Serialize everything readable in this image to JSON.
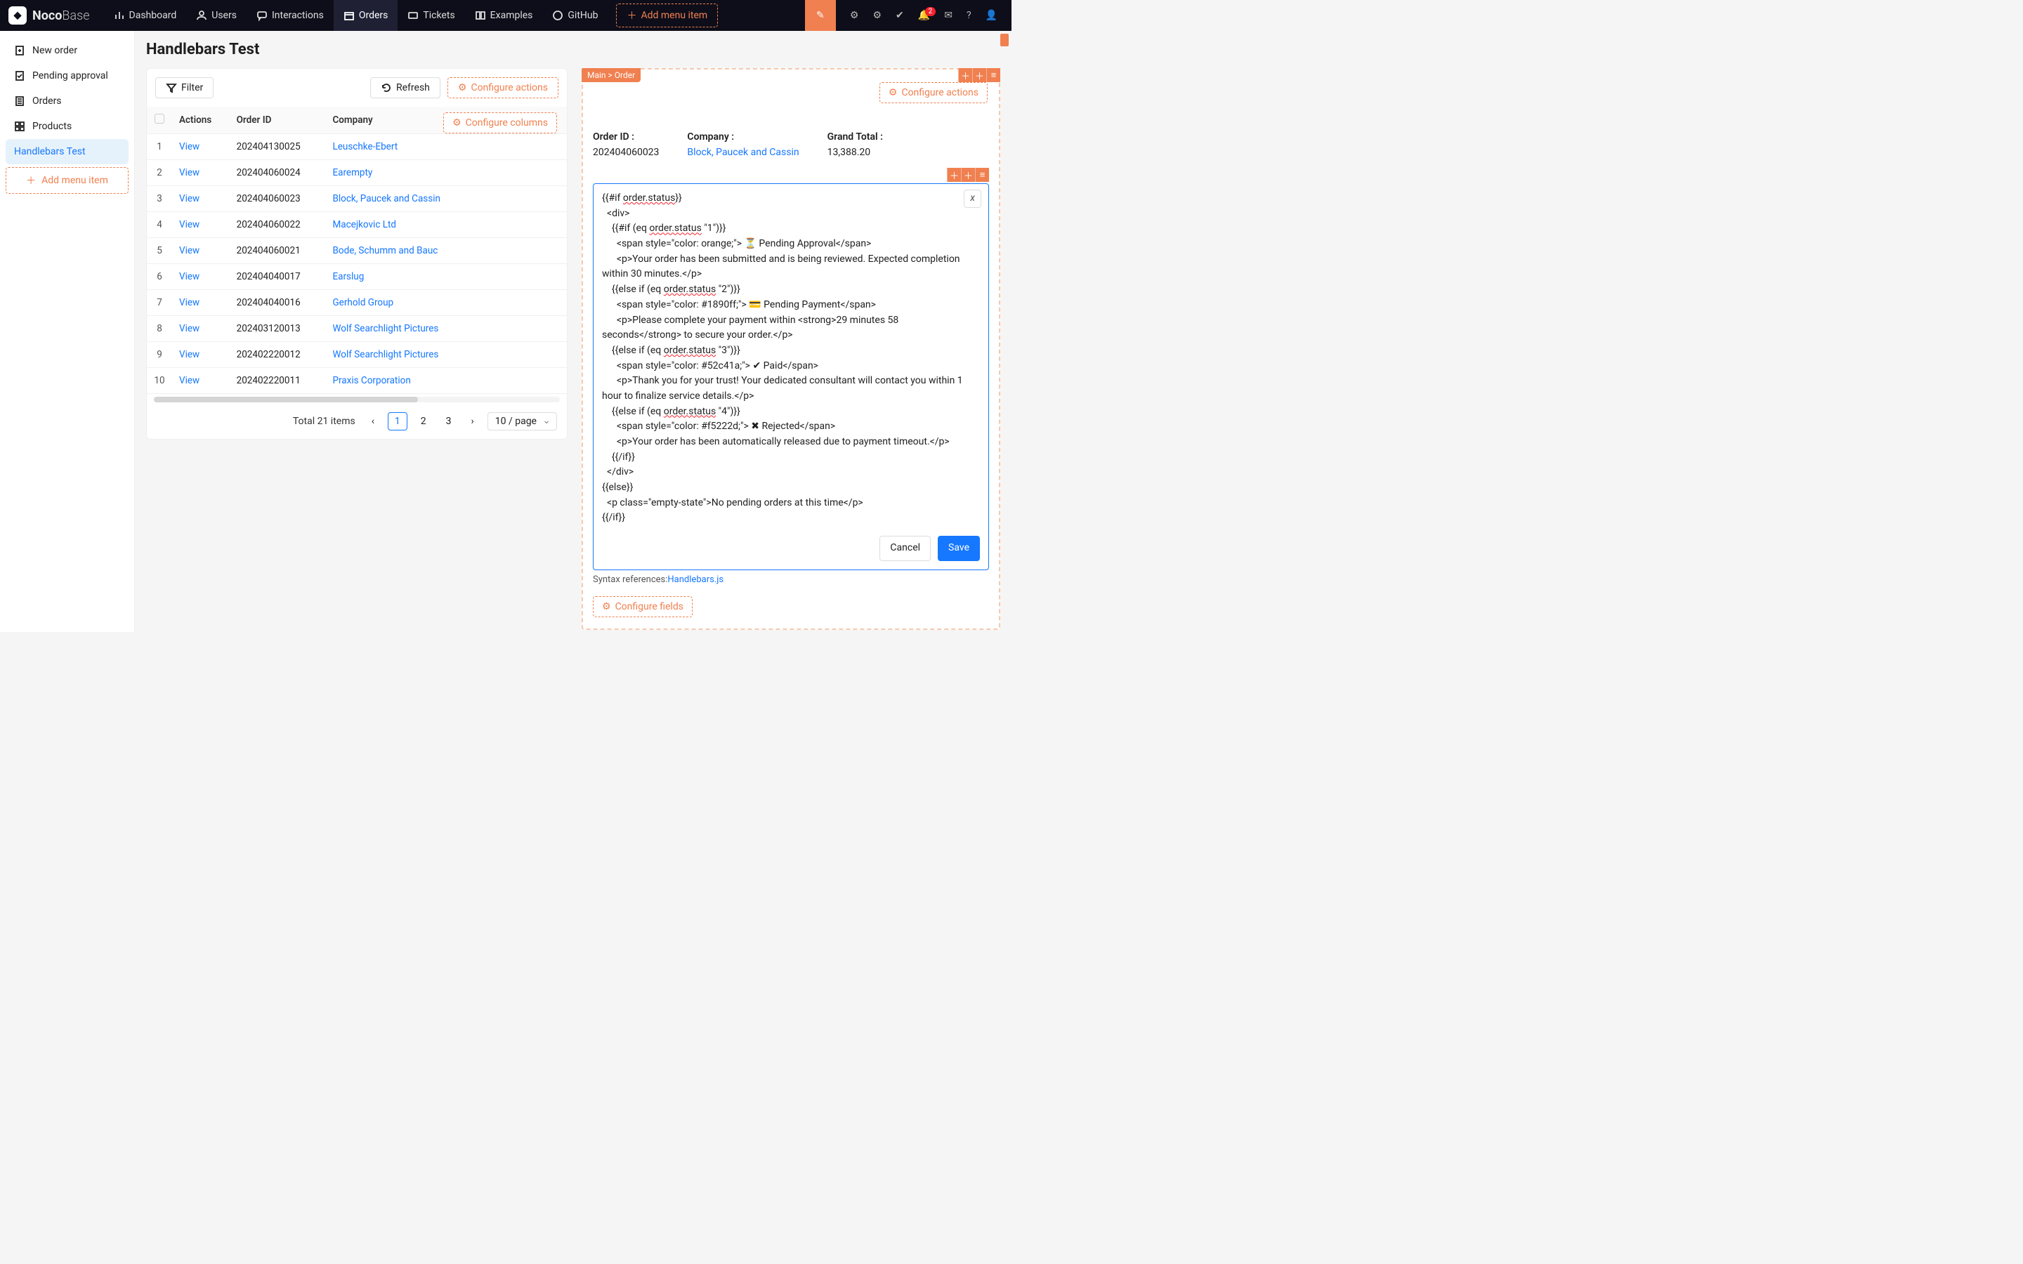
{
  "brand": {
    "name_bold": "Noco",
    "name_light": "Base"
  },
  "topnav": [
    {
      "label": "Dashboard",
      "icon": "chart-icon"
    },
    {
      "label": "Users",
      "icon": "users-icon"
    },
    {
      "label": "Interactions",
      "icon": "chat-icon"
    },
    {
      "label": "Orders",
      "icon": "box-icon",
      "active": true
    },
    {
      "label": "Tickets",
      "icon": "ticket-icon"
    },
    {
      "label": "Examples",
      "icon": "columns-icon"
    },
    {
      "label": "GitHub",
      "icon": "github-icon"
    }
  ],
  "topnav_add": "Add menu item",
  "topbar": {
    "bell_badge": "2"
  },
  "sidebar": [
    {
      "label": "New order",
      "icon": "plus-doc-icon"
    },
    {
      "label": "Pending approval",
      "icon": "approve-icon"
    },
    {
      "label": "Orders",
      "icon": "list-icon"
    },
    {
      "label": "Products",
      "icon": "grid-icon"
    },
    {
      "label": "Handlebars Test",
      "icon": "",
      "active": true
    }
  ],
  "sidebar_add": "Add menu item",
  "page_title": "Handlebars Test",
  "buttons": {
    "filter": "Filter",
    "refresh": "Refresh",
    "configure_actions": "Configure actions",
    "configure_columns": "Configure columns",
    "view": "View",
    "cancel": "Cancel",
    "save": "Save",
    "configure_fields": "Configure fields"
  },
  "table": {
    "headers": {
      "actions": "Actions",
      "order_id": "Order ID",
      "company": "Company"
    },
    "rows": [
      {
        "n": "1",
        "id": "202404130025",
        "company": "Leuschke-Ebert"
      },
      {
        "n": "2",
        "id": "202404060024",
        "company": "Earempty"
      },
      {
        "n": "3",
        "id": "202404060023",
        "company": "Block, Paucek and Cassin"
      },
      {
        "n": "4",
        "id": "202404060022",
        "company": "Macejkovic Ltd"
      },
      {
        "n": "5",
        "id": "202404060021",
        "company": "Bode, Schumm and Bauc"
      },
      {
        "n": "6",
        "id": "202404040017",
        "company": "Earslug"
      },
      {
        "n": "7",
        "id": "202404040016",
        "company": "Gerhold Group"
      },
      {
        "n": "8",
        "id": "202403120013",
        "company": "Wolf Searchlight Pictures"
      },
      {
        "n": "9",
        "id": "202402220012",
        "company": "Wolf Searchlight Pictures"
      },
      {
        "n": "10",
        "id": "202402220011",
        "company": "Praxis Corporation"
      }
    ]
  },
  "pager": {
    "total": "Total 21 items",
    "pages": [
      "1",
      "2",
      "3"
    ],
    "active": "1",
    "page_size": "10 / page"
  },
  "breadcrumb": "Main > Order",
  "detail": {
    "order_id_label": "Order ID",
    "order_id_value": "202404060023",
    "company_label": "Company",
    "company_value": "Block, Paucek and Cassin",
    "grand_total_label": "Grand Total",
    "grand_total_value": "13,388.20"
  },
  "editor": {
    "badge": "x",
    "content": "{{#if order.status}}\n  <div>\n    {{#if (eq order.status \"1\")}}\n      <span style=\"color: orange;\"> ⏳ Pending Approval</span>\n      <p>Your order has been submitted and is being reviewed. Expected completion within 30 minutes.</p>\n    {{else if (eq order.status \"2\")}}\n      <span style=\"color: #1890ff;\"> 💳 Pending Payment</span>\n      <p>Please complete your payment within <strong>29 minutes 58 seconds</strong> to secure your order.</p>\n    {{else if (eq order.status \"3\")}}\n      <span style=\"color: #52c41a;\"> ✔ Paid</span>\n      <p>Thank you for your trust! Your dedicated consultant will contact you within 1 hour to finalize service details.</p>\n    {{else if (eq order.status \"4\")}}\n      <span style=\"color: #f5222d;\"> ✖ Rejected</span>\n      <p>Your order has been automatically released due to payment timeout.</p>\n    {{/if}}\n  </div>\n{{else}}\n  <p class=\"empty-state\">No pending orders at this time</p>\n{{/if}}"
  },
  "refs": {
    "prefix": "Syntax references:",
    "link": "Handlebars.js"
  }
}
